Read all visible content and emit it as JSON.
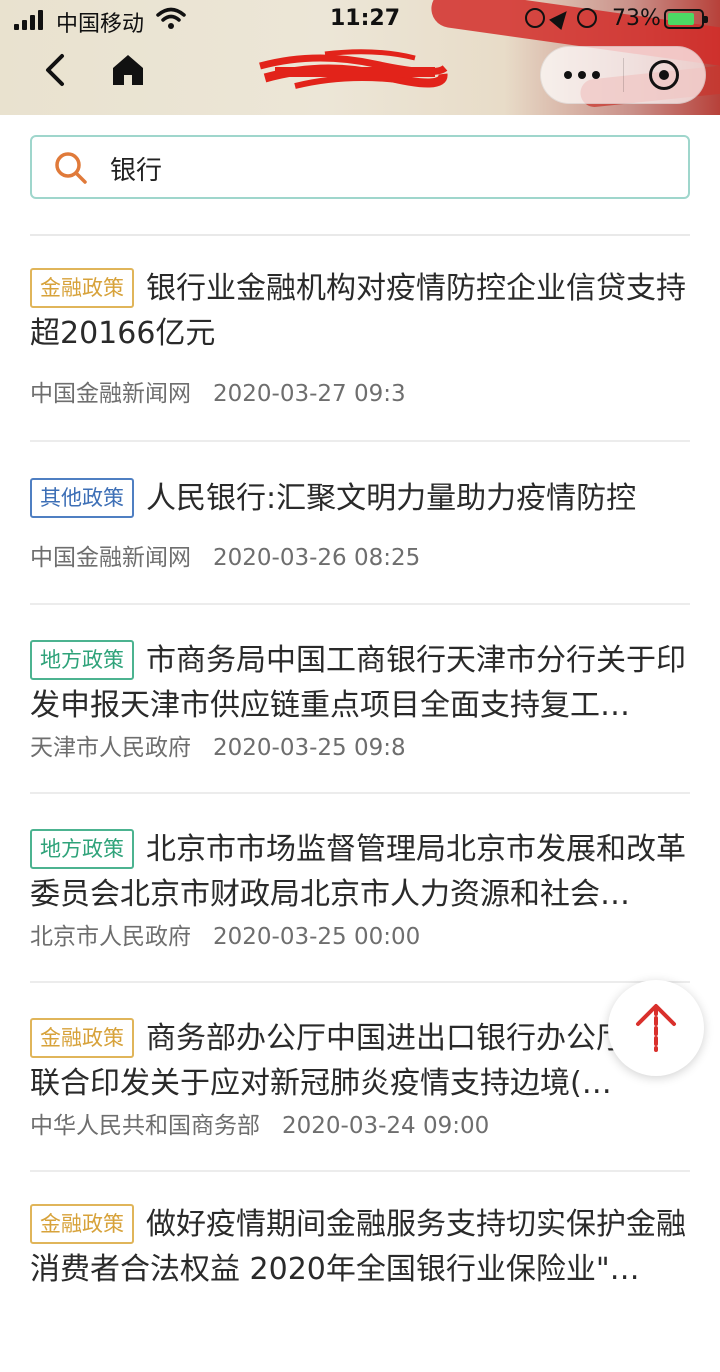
{
  "status_bar": {
    "carrier": "中国移动",
    "time": "11:27",
    "battery_percent": "73%"
  },
  "nav": {
    "title": "",
    "title_obscured": true
  },
  "search": {
    "value": "银行",
    "placeholder": ""
  },
  "articles": [
    {
      "tag": "金融政策",
      "tag_type": "finance",
      "title": "银行业金融机构对疫情防控企业信贷支持超20166亿元",
      "source": "中国金融新闻网",
      "date": "2020-03-27 09:3"
    },
    {
      "tag": "其他政策",
      "tag_type": "other",
      "title": "人民银行:汇聚文明力量助力疫情防控",
      "source": "中国金融新闻网",
      "date": "2020-03-26 08:25"
    },
    {
      "tag": "地方政策",
      "tag_type": "local",
      "title": "市商务局中国工商银行天津市分行关于印发申报天津市供应链重点项目全面支持复工…",
      "source": "天津市人民政府",
      "date": "2020-03-25 09:8"
    },
    {
      "tag": "地方政策",
      "tag_type": "local",
      "title": "北京市市场监督管理局北京市发展和改革委员会北京市财政局北京市人力资源和社会…",
      "source": "北京市人民政府",
      "date": "2020-03-25 00:00"
    },
    {
      "tag": "金融政策",
      "tag_type": "finance",
      "title": "商务部办公厅中国进出口银行办公厅联合印发关于应对新冠肺炎疫情支持边境(跨境)…",
      "source": "中华人民共和国商务部",
      "date": "2020-03-24 09:00"
    },
    {
      "tag": "金融政策",
      "tag_type": "finance",
      "title": "做好疫情期间金融服务支持切实保护金融消费者合法权益 2020年全国银行业保险业\"…",
      "source": "",
      "date": ""
    }
  ],
  "colors": {
    "tag_finance": "#d7a23a",
    "tag_other": "#3d6fb6",
    "tag_local": "#2fa37a",
    "search_border": "#9fd6cc",
    "search_icon": "#e07a3a",
    "fab_arrow": "#d9302c"
  },
  "icons": {
    "back": "chevron-left-icon",
    "home": "home-icon",
    "more": "more-dots-icon",
    "close": "target-close-icon",
    "search": "search-icon",
    "scroll_top": "arrow-up-icon"
  }
}
